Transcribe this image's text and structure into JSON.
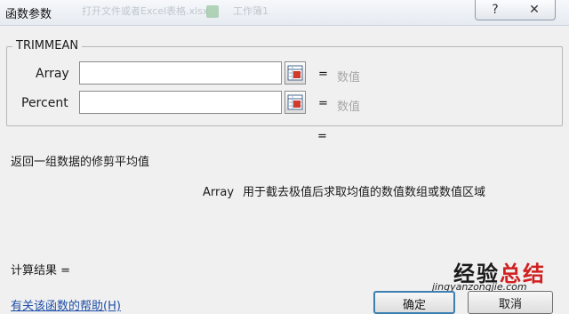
{
  "window": {
    "title": "函数参数",
    "help_glyph": "?",
    "close_glyph": "✕",
    "background_hint_1": "打开文件或者Excel表格.xlsx",
    "background_hint_2": "工作簿1"
  },
  "function": {
    "name": "TRIMMEAN",
    "args": [
      {
        "label": "Array",
        "value": "",
        "equals": "=",
        "hint": "数值"
      },
      {
        "label": "Percent",
        "value": "",
        "equals": "=",
        "hint": "数值"
      }
    ],
    "result_equals": "=",
    "description": "返回一组数据的修剪平均值",
    "arg_desc_name": "Array",
    "arg_desc_text": "用于截去极值后求取均值的数值数组或数值区域"
  },
  "footer": {
    "calc_result": "计算结果 =",
    "help_link": "有关该函数的帮助(H)",
    "ok_label": "确定",
    "cancel_label": "取消"
  },
  "watermark": {
    "text_black": "经验",
    "text_red": "总结",
    "url": "jingyanzongjie.com"
  },
  "icons": {
    "collapse_dialog": "range-select-icon",
    "help": "help-icon",
    "close": "close-icon"
  }
}
